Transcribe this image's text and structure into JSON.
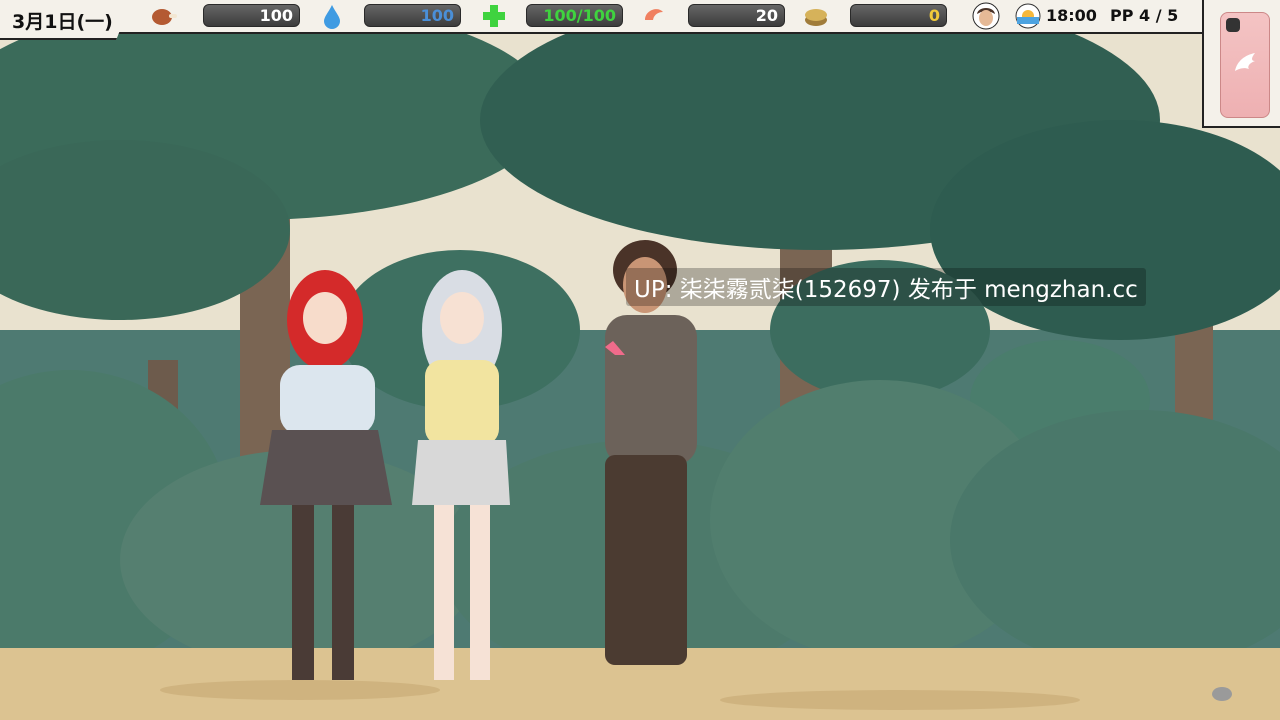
{
  "hud": {
    "date": "3月1日(一)",
    "food": {
      "icon": "roast-meat-icon",
      "value": "100",
      "color": "#ffffff"
    },
    "water": {
      "icon": "water-drop-icon",
      "value": "100",
      "color": "#4a8fd8"
    },
    "health": {
      "icon": "green-cross-icon",
      "value": "100/100",
      "color": "#3fd33f"
    },
    "shrimp": {
      "icon": "shrimp-icon",
      "value": "20",
      "color": "#ffffff"
    },
    "money": {
      "icon": "coin-stack-icon",
      "value": "0",
      "color": "#f0c93a"
    },
    "time": "18:00",
    "pp": "PP 4 / 5"
  },
  "phone": {
    "icon": "wing-icon"
  },
  "watermark": "UP: 柒柒霧贰柒(152697) 发布于 mengzhan.cc",
  "characters": [
    {
      "name": "red-haired-girl"
    },
    {
      "name": "silver-haired-girl"
    },
    {
      "name": "brown-haired-man"
    }
  ]
}
